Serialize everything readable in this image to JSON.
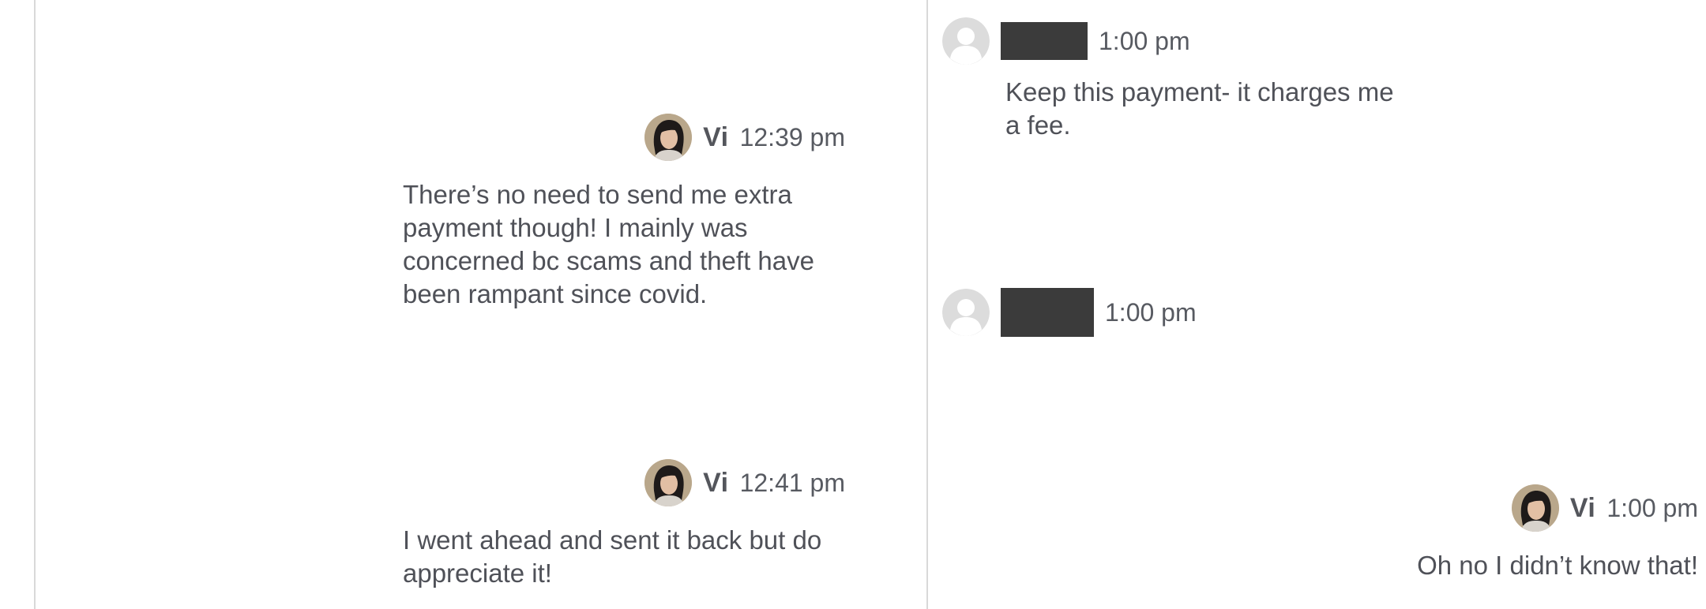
{
  "left_panel": {
    "messages": [
      {
        "sender": "Vi",
        "time": "12:39 pm",
        "text": "There’s no need to send me extra payment though! I mainly was concerned bc scams and theft have been rampant since covid."
      },
      {
        "sender": "Vi",
        "time": "12:41 pm",
        "text": "I went ahead and sent it back but do appreciate it!"
      }
    ]
  },
  "right_panel": {
    "messages": [
      {
        "sender": "",
        "time": "1:00 pm",
        "text": "Keep this payment- it charges me a fee."
      },
      {
        "sender": "",
        "time": "1:00 pm",
        "text": ""
      },
      {
        "sender": "Vi",
        "time": "1:00 pm",
        "text": "Oh no I didn’t know that!"
      }
    ]
  },
  "colors": {
    "redaction": "#3b3b3b",
    "divider": "#d9d9d9",
    "text": "#4f5158"
  },
  "icons": {
    "vi_avatar": "user-photo-icon",
    "other_avatar": "default-user-icon"
  }
}
